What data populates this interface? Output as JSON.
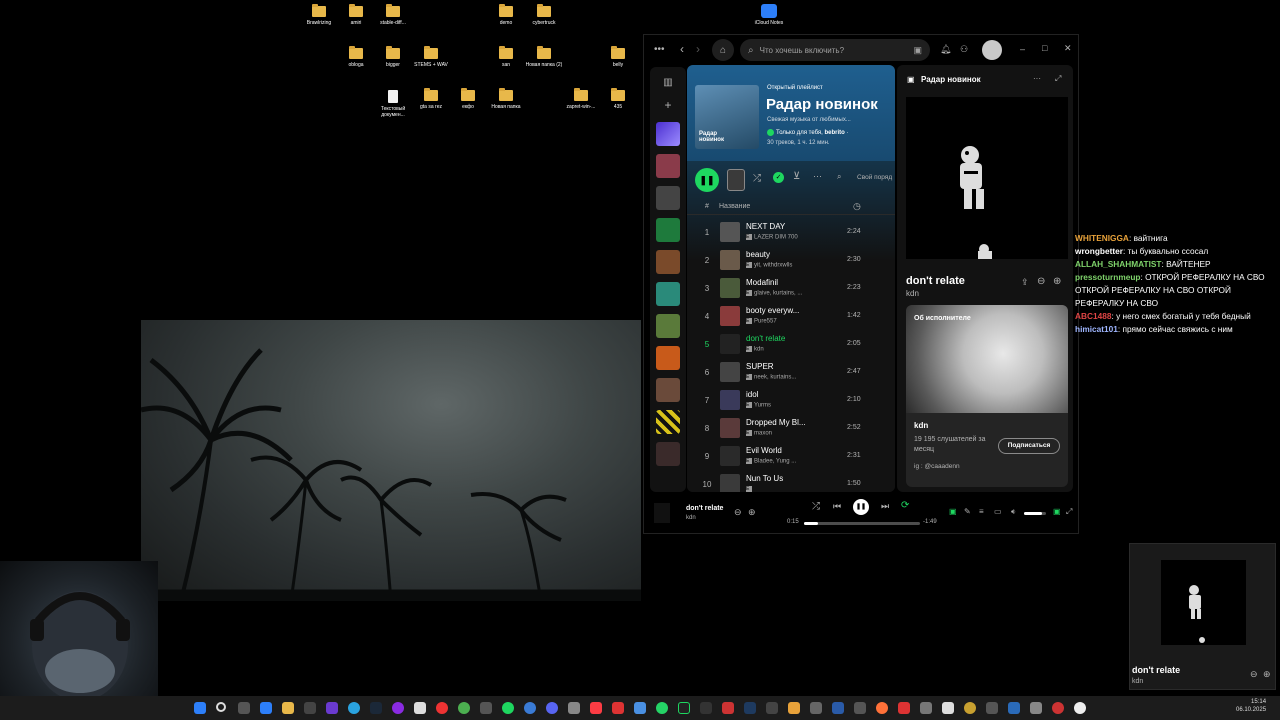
{
  "desktop": {
    "icons": [
      "Brawlrizing",
      "amiri",
      "stable-diff...",
      "demo",
      "cybertruck",
      "iCloud Notes",
      "obloga",
      "bigger",
      "STEMS + WAV",
      "san",
      "Новая папка (2)",
      "belly",
      "Текстовый докумен...",
      "gta sa rez",
      "екфо",
      "Новая папка",
      "zapret-win-...",
      "435"
    ]
  },
  "spotify": {
    "search_placeholder": "Что хочешь включить?",
    "playlist": {
      "kind": "Открытый плейлист",
      "title": "Радар новинок",
      "description": "Свежая музыка от любимых...",
      "meta_prefix": "Только для тебя, ",
      "meta_user": "bebrito",
      "meta_stats": "30 треков, 1 ч. 12 мин.",
      "cover_label": "Радар новинок"
    },
    "sort_label": "Свой поряд",
    "column_title": "Название",
    "tracks": [
      {
        "num": "1",
        "title": "NEXT DAY",
        "artist": "LAZER DIM 700",
        "duration": "2:24"
      },
      {
        "num": "2",
        "title": "beauty",
        "artist": "yit, withdrxwlls",
        "duration": "2:30"
      },
      {
        "num": "3",
        "title": "Modafinil",
        "artist": "glaive, kurtains, ...",
        "duration": "2:23"
      },
      {
        "num": "4",
        "title": "booty everyw...",
        "artist": "Pure557",
        "duration": "1:42"
      },
      {
        "num": "5",
        "title": "don't relate",
        "artist": "kdn",
        "duration": "2:05"
      },
      {
        "num": "6",
        "title": "SUPER",
        "artist": "neek, kurtains...",
        "duration": "2:47"
      },
      {
        "num": "7",
        "title": "idol",
        "artist": "Yurms",
        "duration": "2:10"
      },
      {
        "num": "8",
        "title": "Dropped My Bl...",
        "artist": "maxon",
        "duration": "2:52"
      },
      {
        "num": "9",
        "title": "Evil World",
        "artist": "Bladee, Yung ...",
        "duration": "2:31"
      },
      {
        "num": "10",
        "title": "Nun To Us",
        "artist": "",
        "duration": "1:50"
      }
    ],
    "right_panel": {
      "header": "Радар новинок",
      "song_title": "don't relate",
      "song_artist": "kdn",
      "about_label": "Об исполнителе",
      "artist_name": "kdn",
      "listeners": "19 195 слушателей за месяц",
      "follow_label": "Подписаться",
      "social": "ig : @caaadenn"
    },
    "player": {
      "title": "don't relate",
      "artist": "kdn",
      "elapsed": "0:15",
      "remaining": "-1:49",
      "progress": 0.12
    }
  },
  "chat": [
    {
      "user": "WHITENIGGA",
      "color": "#e8a23a",
      "text": "вайтнига"
    },
    {
      "user": "wrongbetter",
      "color": "#ffffff",
      "text": "ты буквально ссосал"
    },
    {
      "user": "ALLAH_SHAHMATIST",
      "color": "#7fd36b",
      "text": "ВАЙТЕНЕР"
    },
    {
      "user": "pressoturnmeup",
      "color": "#7fd36b",
      "text": "ОТКРОЙ РЕФЕРАЛКУ НА СВО ОТКРОЙ РЕФЕРАЛКУ НА СВО ОТКРОЙ РЕФЕРАЛКУ НА СВО"
    },
    {
      "user": "ABC1488",
      "color": "#e04545",
      "text": "у него смех богатый у тебя бедный"
    },
    {
      "user": "himicat101",
      "color": "#9fb6ff",
      "text": "прямо сейчас свяжись с ним"
    }
  ],
  "mini_player": {
    "title": "don't relate",
    "artist": "kdn"
  },
  "clock": {
    "time": "15:14",
    "date": "06.10.2025"
  },
  "colors": {
    "spotify_green": "#1ed760",
    "playlist_blue": "#1f5f8f"
  }
}
